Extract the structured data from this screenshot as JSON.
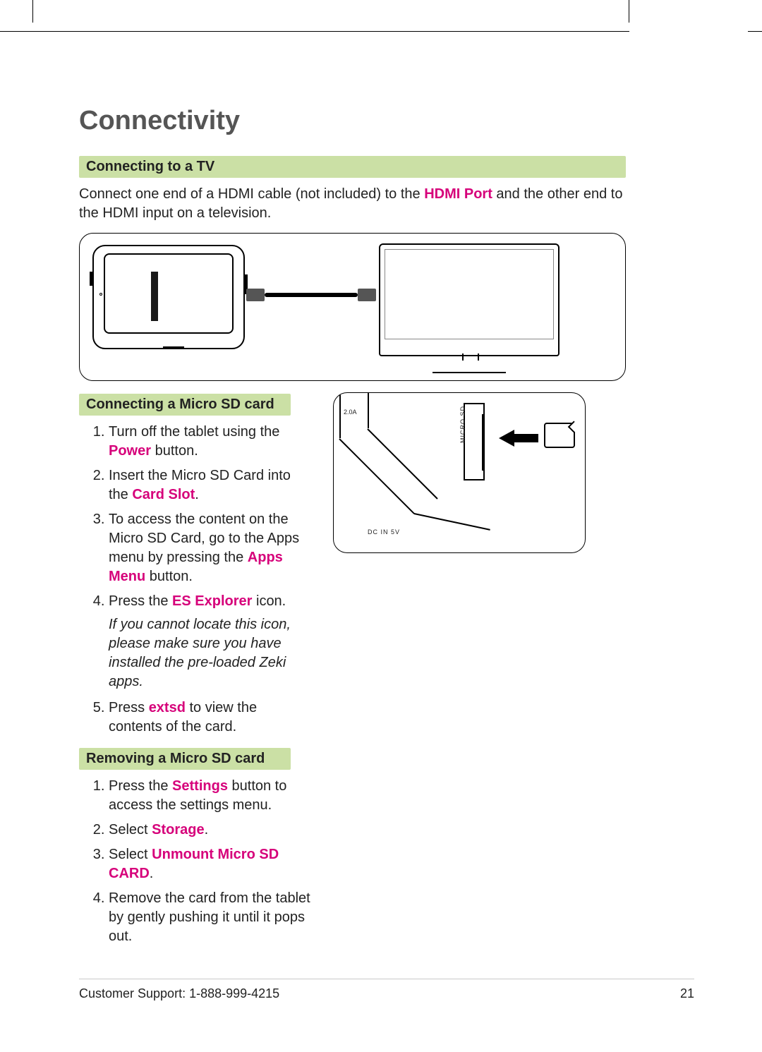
{
  "title": "Connectivity",
  "sections": {
    "tv": {
      "heading": "Connecting to a TV",
      "intro_pre": "Connect one end of a HDMI cable (not included) to the ",
      "intro_hl": "HDMI Port",
      "intro_post": " and the other end to the HDMI input on a television."
    },
    "sd_insert": {
      "heading": "Connecting a Micro SD card",
      "steps": [
        {
          "pre": "Turn off the tablet using the ",
          "hl": "Power",
          "post": " button."
        },
        {
          "pre": "Insert the Micro SD Card into the ",
          "hl": "Card Slot",
          "post": "."
        },
        {
          "pre": "To access the content on the Micro SD Card, go to the Apps menu by pressing the ",
          "hl": "Apps Menu",
          "post": " button."
        },
        {
          "pre": "Press the ",
          "hl": "ES Explorer",
          "post": " icon."
        },
        {
          "pre": "Press ",
          "hl": "extsd",
          "post": " to view the contents of the card."
        }
      ],
      "note": "If you cannot locate this icon, please make sure you have installed the pre-loaded Zeki apps."
    },
    "sd_remove": {
      "heading": "Removing a Micro SD card",
      "steps": [
        {
          "pre": "Press the ",
          "hl": "Settings",
          "post": " button to access the settings menu."
        },
        {
          "pre": "Select ",
          "hl": "Storage",
          "post": "."
        },
        {
          "pre": "Select ",
          "hl": "Unmount Micro SD CARD",
          "post": "."
        },
        {
          "pre": "Remove the card from the tablet by gently pushing it until it pops out.",
          "hl": "",
          "post": ""
        }
      ]
    }
  },
  "figure_labels": {
    "micro_sd": "MICRO SD",
    "amp": "2.0A",
    "dc": "DC IN 5V"
  },
  "footer": {
    "support": "Customer Support: 1-888-999-4215",
    "page": "21"
  }
}
